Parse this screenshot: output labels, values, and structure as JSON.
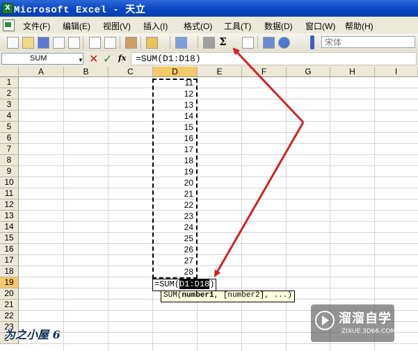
{
  "window": {
    "title": "Microsoft Excel - 天立",
    "app_icon": "excel-icon"
  },
  "menu": [
    "文件(F)",
    "编辑(E)",
    "视图(V)",
    "插入(I)",
    "格式(O)",
    "工具(T)",
    "数据(D)",
    "窗口(W)",
    "帮助(H)"
  ],
  "toolbar": {
    "autosum_label": "Σ",
    "font_name": "宋体"
  },
  "formula_bar": {
    "name_box": "SUM",
    "cancel": "✕",
    "enter": "✓",
    "fx": "fx",
    "formula": "=SUM(D1:D18)"
  },
  "grid": {
    "columns": [
      "A",
      "B",
      "C",
      "D",
      "E",
      "F",
      "G",
      "H",
      "I"
    ],
    "active_column": "D",
    "rows": [
      "1",
      "2",
      "3",
      "4",
      "5",
      "6",
      "7",
      "8",
      "9",
      "10",
      "11",
      "12",
      "13",
      "14",
      "15",
      "16",
      "17",
      "18",
      "19",
      "20",
      "21",
      "22",
      "23",
      "24"
    ],
    "active_row": "19",
    "d_values": [
      "11",
      "12",
      "13",
      "14",
      "15",
      "16",
      "17",
      "18",
      "19",
      "20",
      "21",
      "22",
      "23",
      "24",
      "25",
      "26",
      "27",
      "28"
    ]
  },
  "editing": {
    "prefix": "=SUM(",
    "selected": "D1:D18",
    "suffix": ")"
  },
  "tooltip": {
    "fn": "SUM(",
    "arg1": "number1",
    "rest": ", [number2], ...)"
  },
  "watermark_left": "为之小屋 6",
  "watermark_right": {
    "brand": "溜溜自学",
    "site": "ZIXUE.3D66.COM"
  },
  "annotation_color": "#d42020"
}
